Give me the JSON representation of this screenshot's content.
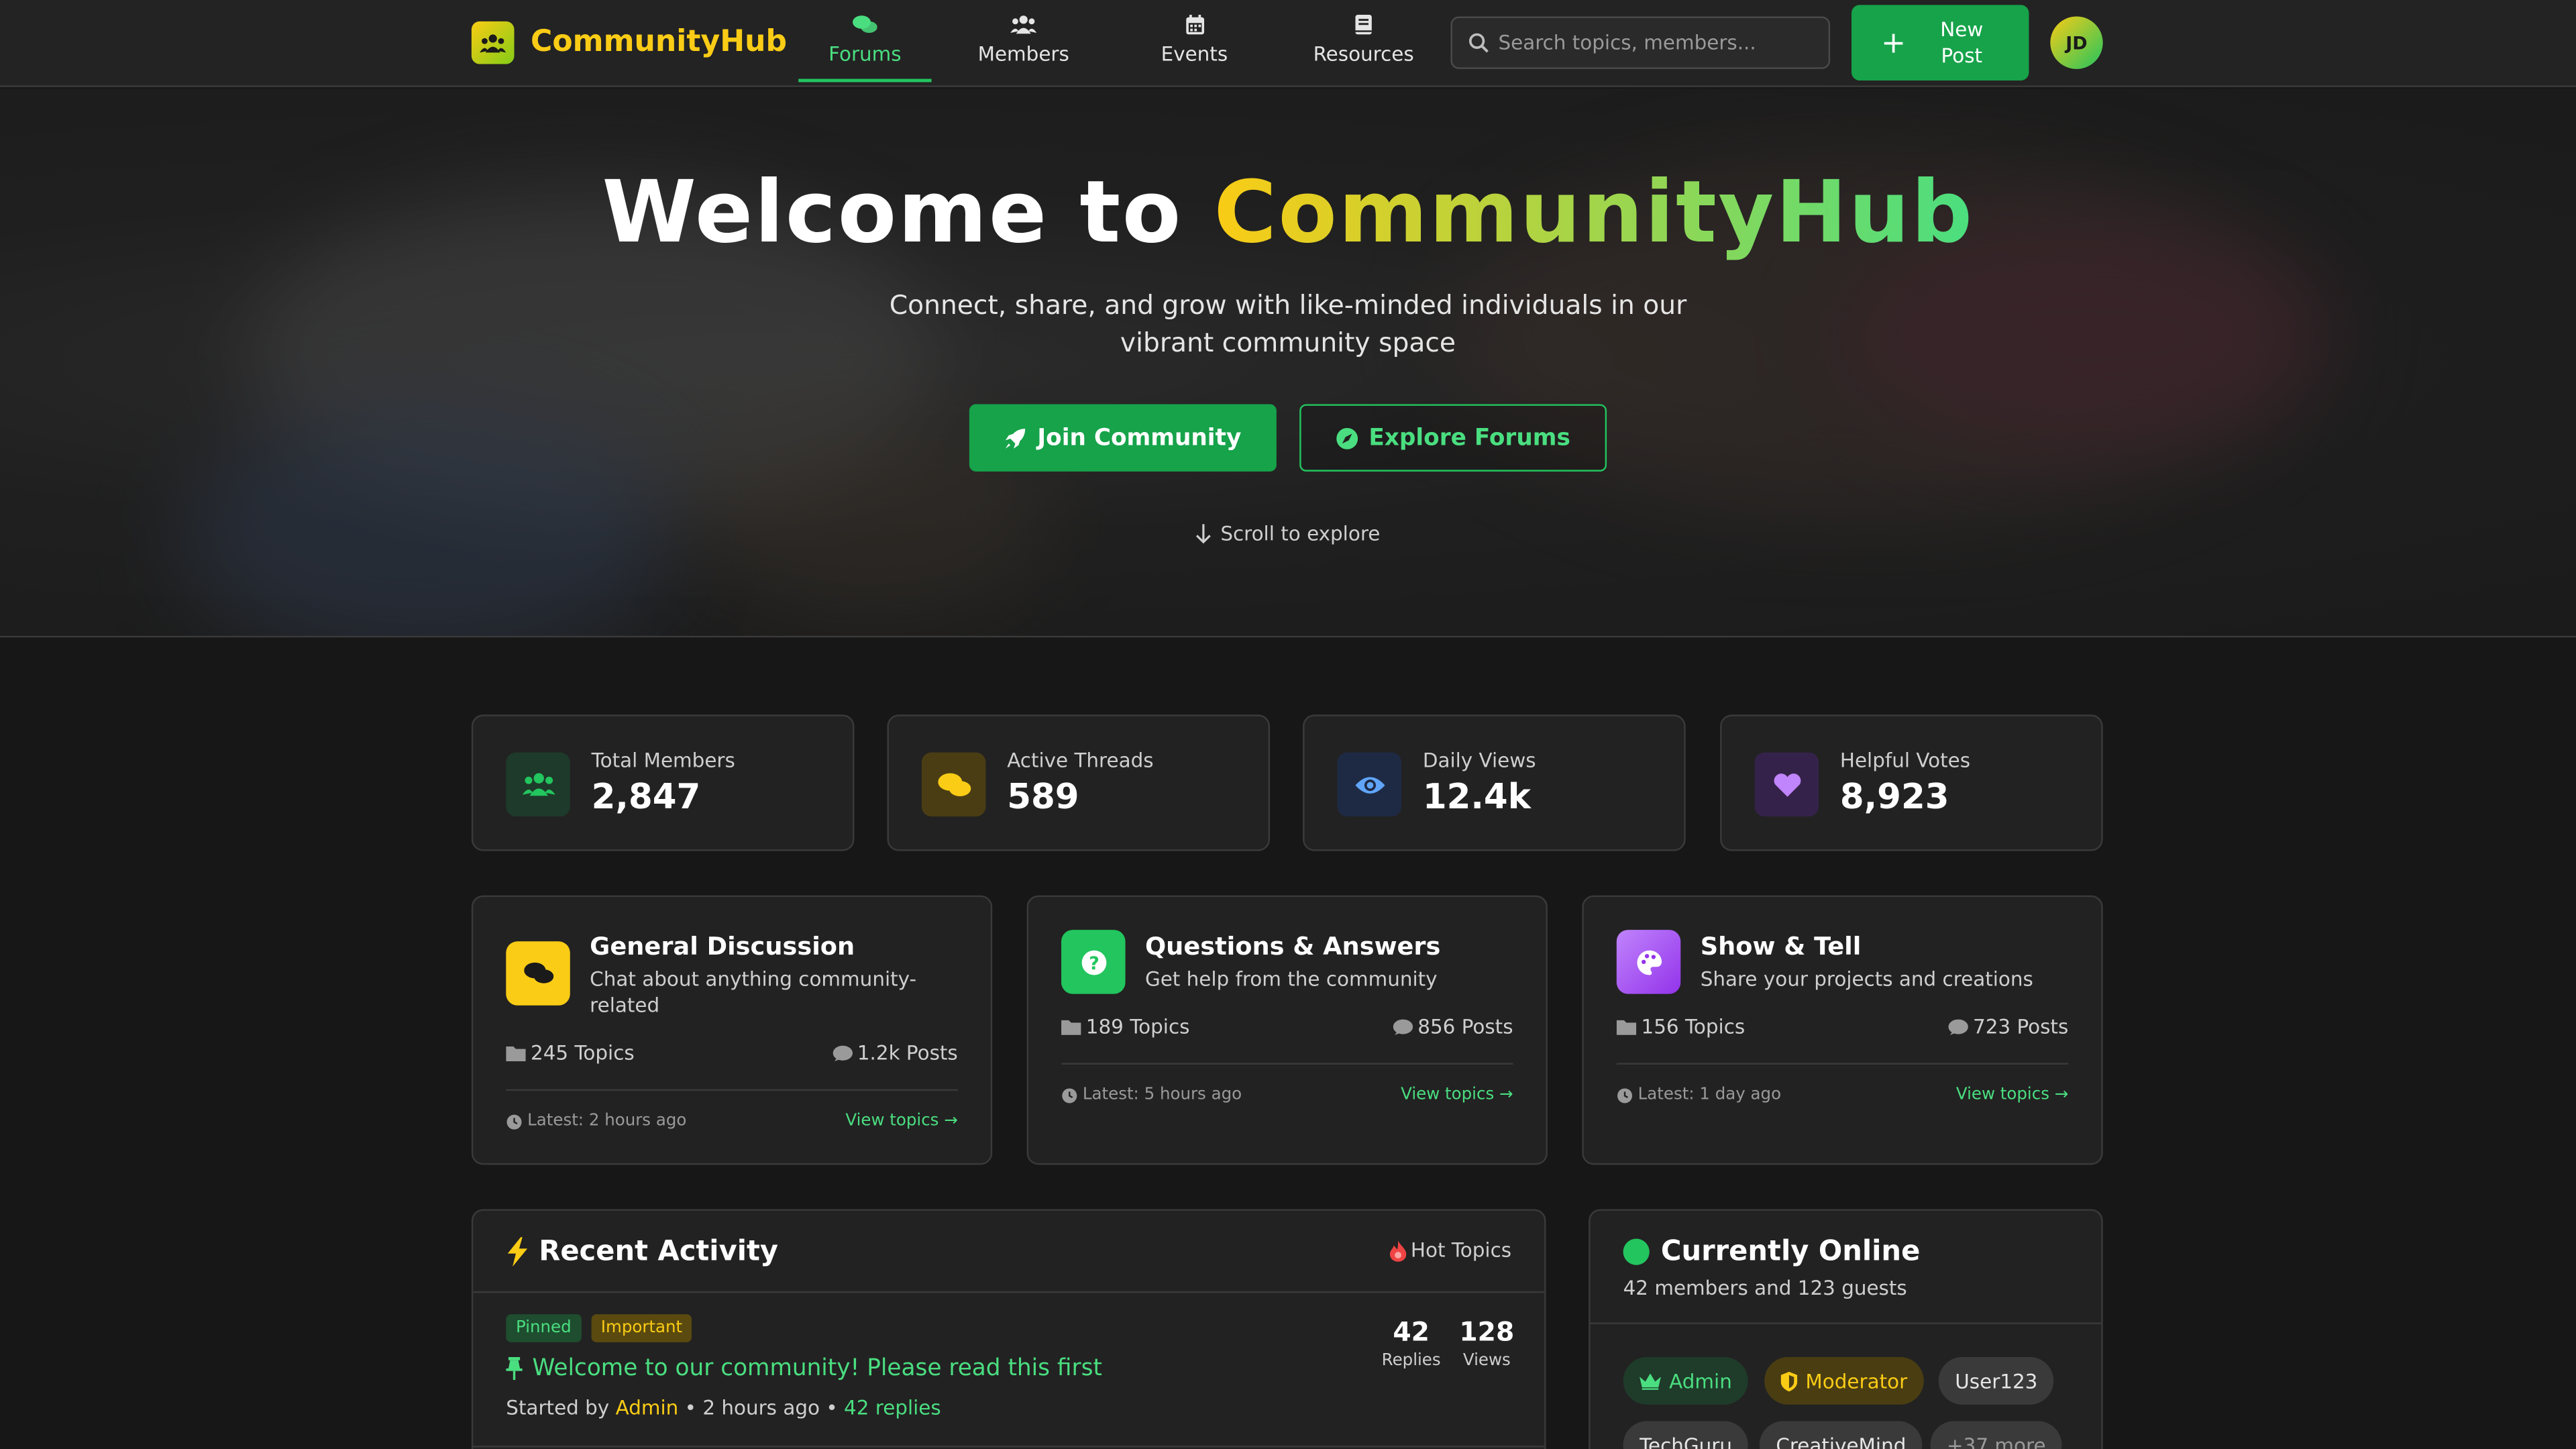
{
  "header": {
    "brand": "CommunityHub",
    "nav": [
      {
        "label": "Forums",
        "icon": "comments-icon",
        "active": true
      },
      {
        "label": "Members",
        "icon": "users-icon",
        "active": false
      },
      {
        "label": "Events",
        "icon": "calendar-icon",
        "active": false
      },
      {
        "label": "Resources",
        "icon": "book-icon",
        "active": false
      }
    ],
    "search_placeholder": "Search topics, members...",
    "new_post_label": "New Post",
    "avatar_initials": "JD"
  },
  "hero": {
    "title_prefix": "Welcome to",
    "title_highlight": "CommunityHub",
    "subtitle": "Connect, share, and grow with like-minded individuals in our vibrant community space",
    "join_label": "Join Community",
    "explore_label": "Explore Forums",
    "scroll_label": "Scroll to explore"
  },
  "stats": [
    {
      "label": "Total Members",
      "value": "2,847",
      "icon": "users-icon",
      "color": "#22c55e"
    },
    {
      "label": "Active Threads",
      "value": "589",
      "icon": "comments-icon",
      "color": "#facc15"
    },
    {
      "label": "Daily Views",
      "value": "12.4k",
      "icon": "eye-icon",
      "color": "#60a5fa"
    },
    {
      "label": "Helpful Votes",
      "value": "8,923",
      "icon": "heart-icon",
      "color": "#c084fc"
    }
  ],
  "categories": [
    {
      "title": "General Discussion",
      "desc": "Chat about anything community-related",
      "topics": "245 Topics",
      "posts": "1.2k Posts",
      "latest": "Latest: 2 hours ago",
      "view": "View topics →",
      "color": "#facc15"
    },
    {
      "title": "Questions & Answers",
      "desc": "Get help from the community",
      "topics": "189 Topics",
      "posts": "856 Posts",
      "latest": "Latest: 5 hours ago",
      "view": "View topics →",
      "color": "#22c55e"
    },
    {
      "title": "Show & Tell",
      "desc": "Share your projects and creations",
      "topics": "156 Topics",
      "posts": "723 Posts",
      "latest": "Latest: 1 day ago",
      "view": "View topics →",
      "color": "#a855f7"
    }
  ],
  "recent": {
    "title": "Recent Activity",
    "hot_label": "Hot Topics",
    "thread": {
      "badges": [
        "Pinned",
        "Important"
      ],
      "title": "Welcome to our community! Please read this first",
      "started_by": "Started by",
      "author": "Admin",
      "time": "• 2 hours ago •",
      "replies_link": "42 replies",
      "replies": "42",
      "replies_label": "Replies",
      "views": "128",
      "views_label": "Views"
    }
  },
  "online": {
    "title": "Currently Online",
    "subtitle": "42 members and 123 guests",
    "users": [
      "Admin",
      "Moderator",
      "User123",
      "TechGuru",
      "CreativeMind",
      "+37 more"
    ]
  }
}
